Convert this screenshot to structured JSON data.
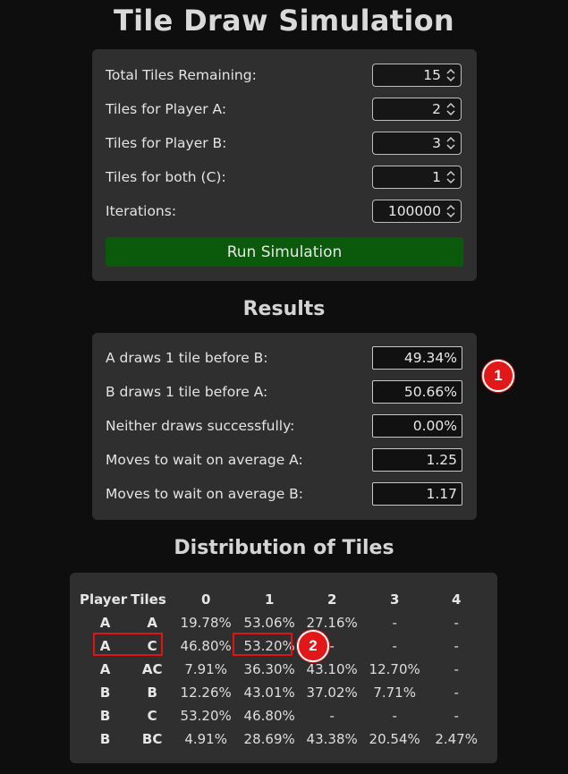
{
  "title": "Tile Draw Simulation",
  "inputs": [
    {
      "label": "Total Tiles Remaining:",
      "value": "15"
    },
    {
      "label": "Tiles for Player A:",
      "value": "2"
    },
    {
      "label": "Tiles for Player B:",
      "value": "3"
    },
    {
      "label": "Tiles for both (C):",
      "value": "1"
    },
    {
      "label": "Iterations:",
      "value": "100000"
    }
  ],
  "run_button": "Run Simulation",
  "results_title": "Results",
  "results": [
    {
      "label": "A draws 1 tile before B:",
      "value": "49.34%"
    },
    {
      "label": "B draws 1 tile before A:",
      "value": "50.66%"
    },
    {
      "label": "Neither draws successfully:",
      "value": "0.00%"
    },
    {
      "label": "Moves to wait on average A:",
      "value": "1.25"
    },
    {
      "label": "Moves to wait on average B:",
      "value": "1.17"
    }
  ],
  "distribution_title": "Distribution of Tiles",
  "distribution": {
    "headers": [
      "Player",
      "Tiles",
      "0",
      "1",
      "2",
      "3",
      "4"
    ],
    "rows": [
      [
        "A",
        "A",
        "19.78%",
        "53.06%",
        "27.16%",
        "-",
        "-"
      ],
      [
        "A",
        "C",
        "46.80%",
        "53.20%",
        "-",
        "-",
        "-"
      ],
      [
        "A",
        "AC",
        "7.91%",
        "36.30%",
        "43.10%",
        "12.70%",
        "-"
      ],
      [
        "B",
        "B",
        "12.26%",
        "43.01%",
        "37.02%",
        "7.71%",
        "-"
      ],
      [
        "B",
        "C",
        "53.20%",
        "46.80%",
        "-",
        "-",
        "-"
      ],
      [
        "B",
        "BC",
        "4.91%",
        "28.69%",
        "43.38%",
        "20.54%",
        "2.47%"
      ]
    ]
  },
  "annotations": [
    "1",
    "2"
  ],
  "colors": {
    "background": "#0e0e0e",
    "panel": "#2f2f2f",
    "run_button": "#0b5a0b",
    "marker": "#e21818"
  }
}
